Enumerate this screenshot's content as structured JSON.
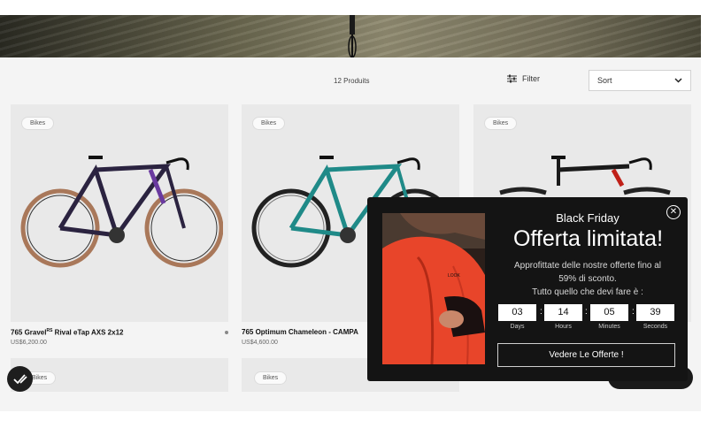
{
  "toolbar": {
    "count": "12 Produits",
    "filter_label": "Filter",
    "filter_icon": "sliders-icon",
    "sort_value": "Sort",
    "sort_icon": "chevron-down-icon"
  },
  "products": [
    {
      "badge": "Bikes",
      "name": "765 Gravel",
      "name_sup": "RS",
      "name_suffix": " Rival eTap AXS 2x12",
      "price": "US$6,200.00",
      "frame_color": "#2b2340",
      "accent": "#6a3aa0",
      "tire": "#a9785a"
    },
    {
      "badge": "Bikes",
      "name": "765 Optimum Chameleon - CAMPA",
      "price": "US$4,600.00",
      "frame_color": "#1f8a88",
      "accent": "#2a2a2a",
      "tire": "#222222"
    },
    {
      "badge": "Bikes",
      "frame_color": "#1a1a1a",
      "accent": "#c02018",
      "tire": "#222222"
    }
  ],
  "products_row2": [
    {
      "badge": "Bikes"
    },
    {
      "badge": "Bikes"
    }
  ],
  "popup": {
    "eyebrow": "Black Friday",
    "headline": "Offerta limitata!",
    "desc_line1": "Approfittate delle nostre offerte fino al",
    "desc_line2": "59% di sconto.",
    "desc_line3": "Tutto quello che devi fare è :",
    "countdown": [
      {
        "value": "03",
        "label": "Days"
      },
      {
        "value": "14",
        "label": "Hours"
      },
      {
        "value": "05",
        "label": "Minutes"
      },
      {
        "value": "39",
        "label": "Seconds"
      }
    ],
    "cta": "Vedere Le Offerte !",
    "close_icon": "close-icon",
    "photo_brand": "LOOK"
  },
  "colors": {
    "popup_bg": "#141414",
    "shop_bg": "#f4f4f4",
    "card_bg": "#e9e9e9"
  }
}
